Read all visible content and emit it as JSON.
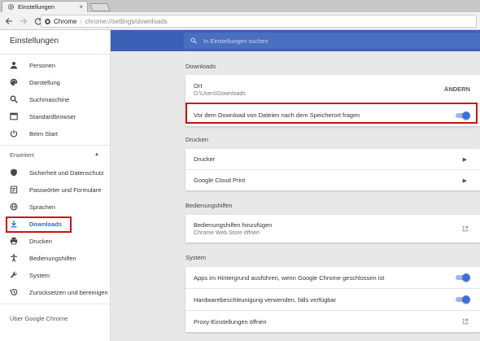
{
  "window": {
    "tab_title": "Einstellungen",
    "tab_close": "×",
    "url_scheme_label": "Chrome",
    "url_path": "chrome://settings/downloads"
  },
  "sidebar": {
    "title": "Einstellungen",
    "items": [
      {
        "label": "Personen",
        "icon": "person-icon"
      },
      {
        "label": "Darstellung",
        "icon": "palette-icon"
      },
      {
        "label": "Suchmaschine",
        "icon": "search-icon"
      },
      {
        "label": "Standardbrowser",
        "icon": "browser-icon"
      },
      {
        "label": "Beim Start",
        "icon": "power-icon"
      }
    ],
    "advanced_label": "Erweitert",
    "advanced_items": [
      {
        "label": "Sicherheit und Datenschutz",
        "icon": "shield-icon"
      },
      {
        "label": "Passwörter und Formulare",
        "icon": "key-icon"
      },
      {
        "label": "Sprachen",
        "icon": "globe-icon"
      },
      {
        "label": "Downloads",
        "icon": "download-icon",
        "active": true
      },
      {
        "label": "Drucken",
        "icon": "printer-icon"
      },
      {
        "label": "Bedienungshilfen",
        "icon": "accessibility-icon"
      },
      {
        "label": "System",
        "icon": "wrench-icon"
      },
      {
        "label": "Zurücksetzen und bereinigen",
        "icon": "restore-icon"
      }
    ],
    "about_label": "Über Google Chrome"
  },
  "search": {
    "placeholder": "In Einstellungen suchen"
  },
  "sections": {
    "downloads": {
      "title": "Downloads",
      "location_label": "Ort",
      "location_value": "D:\\Users\\Downloads",
      "change_button": "ÄNDERN",
      "ask_location_label": "Vor dem Download von Dateien nach dem Speicherort fragen",
      "ask_location_enabled": true
    },
    "printing": {
      "title": "Drucken",
      "printer_label": "Drucker",
      "cloud_print_label": "Google Cloud Print"
    },
    "accessibility": {
      "title": "Bedienungshilfen",
      "add_label": "Bedienungshilfen hinzufügen",
      "add_sub": "Chrome Web Store öffnen"
    },
    "system": {
      "title": "System",
      "background_apps_label": "Apps im Hintergrund ausführen, wenn Google Chrome geschlossen ist",
      "background_apps_enabled": true,
      "hw_accel_label": "Hardwarebeschleunigung verwenden, falls verfügbar",
      "hw_accel_enabled": true,
      "proxy_label": "Proxy-Einstellungen öffnen"
    }
  },
  "colors": {
    "accent_blue": "#3b60b6",
    "toggle_blue": "#3b6fd9",
    "highlight_red": "#d01010"
  }
}
